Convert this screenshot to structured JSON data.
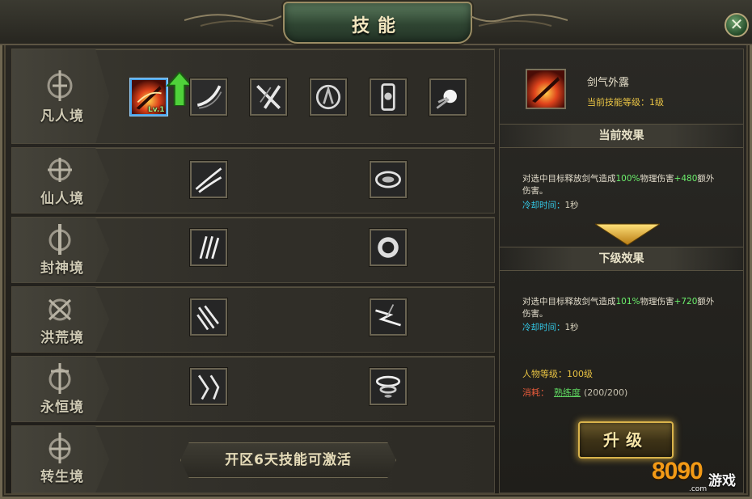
{
  "window": {
    "title": "技能",
    "close_glyph": "✕"
  },
  "tiers": [
    {
      "name": "凡人境",
      "skills": [
        "sword-slash-fire-icon",
        "blade-arc-icon",
        "cross-slash-icon",
        "spirit-shield-icon",
        "totem-icon",
        "comet-icon"
      ]
    },
    {
      "name": "仙人境",
      "skills": [
        "wind-blades-icon",
        "vortex-ring-icon"
      ]
    },
    {
      "name": "封神境",
      "skills": [
        "claw-strike-icon",
        "dark-orb-icon"
      ]
    },
    {
      "name": "洪荒境",
      "skills": [
        "rain-strike-icon",
        "lightning-burst-icon"
      ]
    },
    {
      "name": "永恒境",
      "skills": [
        "beast-fang-icon",
        "tornado-icon"
      ]
    },
    {
      "name": "转生境",
      "activate_text": "开区6天技能可激活"
    }
  ],
  "selected_skill": {
    "level_badge": "Lv.1"
  },
  "detail": {
    "name": "剑气外露",
    "current_level": "当前技能等级：1级",
    "current_effect_title": "当前效果",
    "current_desc_pre": "对选中目标释放剑气造成",
    "current_pct": "100%",
    "current_mid": "物理伤害",
    "current_bonus": "+480",
    "current_desc_post": "额外伤害。",
    "cooldown_label": "冷却时间：",
    "cooldown_value": "1秒",
    "next_effect_title": "下级效果",
    "next_desc_pre": "对选中目标释放剑气造成",
    "next_pct": "101%",
    "next_mid": "物理伤害",
    "next_bonus": "+720",
    "next_desc_post": "额外伤害。",
    "next_cooldown_value": "1秒",
    "req_level": "人物等级：100级",
    "cost_label": "消耗：",
    "cost_item": "熟练度",
    "cost_amount": "(200/200)",
    "upgrade_label": "升级"
  },
  "watermark": {
    "digits": "8090",
    "cn": "游戏",
    "domain": ".com"
  },
  "colors": {
    "accent_gold": "#e9c445",
    "green": "#6cf06c",
    "cooldown": "#33c8e6",
    "cost_red": "#e85b3b"
  }
}
